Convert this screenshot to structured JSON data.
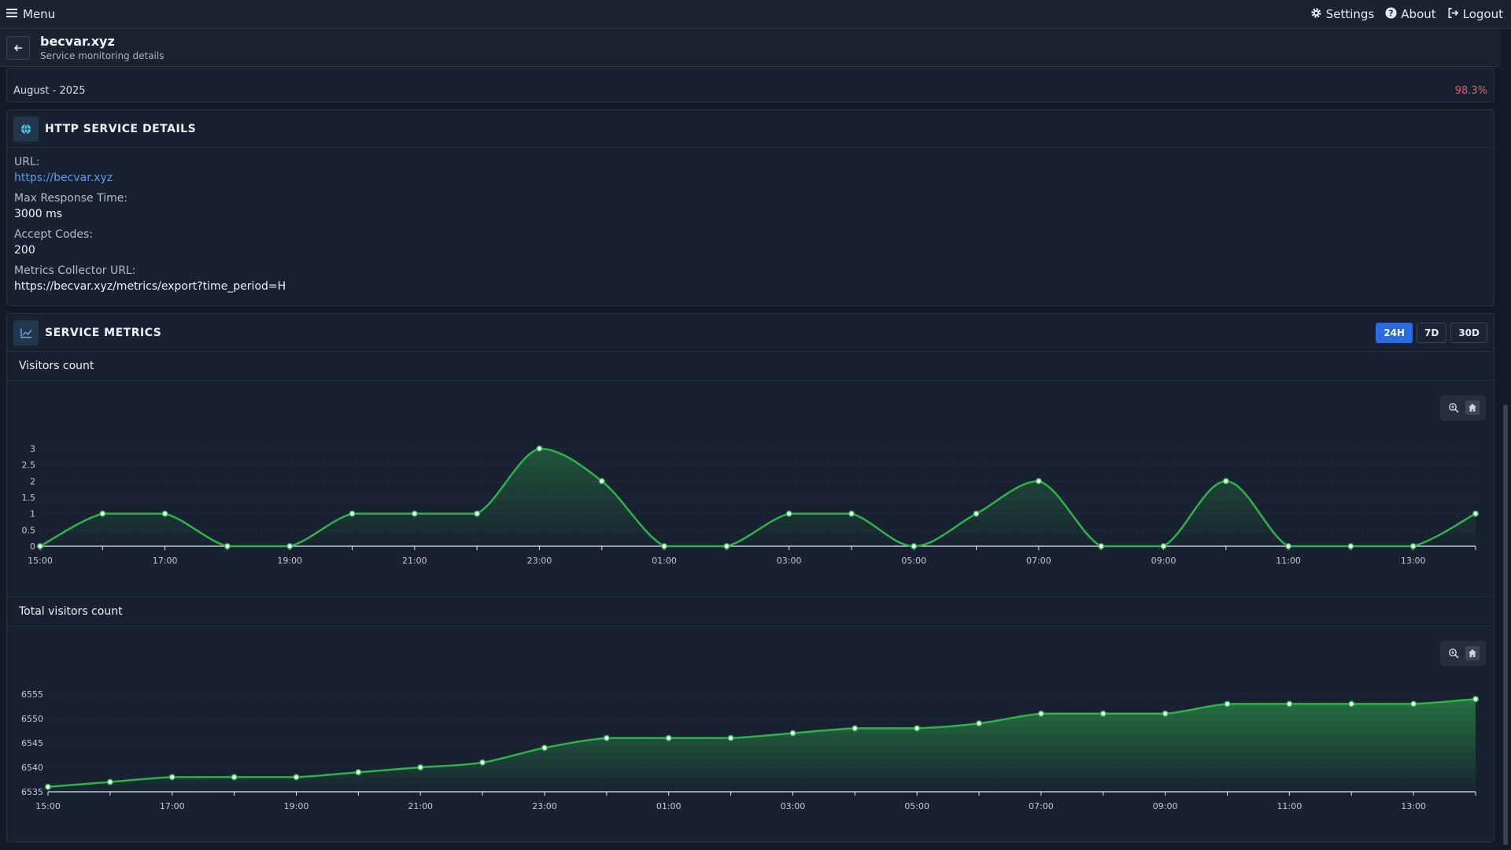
{
  "topbar": {
    "menu_label": "Menu",
    "settings_label": "Settings",
    "about_label": "About",
    "logout_label": "Logout"
  },
  "header": {
    "title": "becvar.xyz",
    "subtitle": "Service monitoring details"
  },
  "uptime": {
    "period": "August - 2025",
    "percent": "98.3%"
  },
  "http_details": {
    "section_title": "HTTP SERVICE DETAILS",
    "url_label": "URL:",
    "url_value": "https://becvar.xyz",
    "max_response_label": "Max Response Time:",
    "max_response_value": "3000 ms",
    "accept_codes_label": "Accept Codes:",
    "accept_codes_value": "200",
    "metrics_url_label": "Metrics Collector URL:",
    "metrics_url_value": "https://becvar.xyz/metrics/export?time_period=H"
  },
  "metrics": {
    "section_title": "SERVICE METRICS",
    "periods": [
      "24H",
      "7D",
      "30D"
    ],
    "active_period": "24H"
  },
  "colors": {
    "line": "#2fb24c",
    "accent": "#2a6be0",
    "downtime": "#e0606a",
    "link": "#5b9ef0"
  },
  "chart_data": [
    {
      "type": "area",
      "title": "Visitors count",
      "x": [
        "15:00",
        "16:00",
        "17:00",
        "18:00",
        "19:00",
        "20:00",
        "21:00",
        "22:00",
        "23:00",
        "00:00",
        "01:00",
        "02:00",
        "03:00",
        "04:00",
        "05:00",
        "06:00",
        "07:00",
        "08:00",
        "09:00",
        "10:00",
        "11:00",
        "12:00",
        "13:00",
        "14:00"
      ],
      "x_tick_labels": [
        "15:00",
        "17:00",
        "19:00",
        "21:00",
        "23:00",
        "01:00",
        "03:00",
        "05:00",
        "07:00",
        "09:00",
        "11:00",
        "13:00"
      ],
      "values": [
        0,
        1,
        1,
        0,
        0,
        1,
        1,
        1,
        3,
        2,
        0,
        0,
        1,
        1,
        0,
        1,
        2,
        0,
        0,
        2,
        0,
        0,
        0,
        1
      ],
      "y_ticks": [
        "0",
        "0.5",
        "1",
        "1.5",
        "2",
        "2.5",
        "3"
      ],
      "ylim": [
        0,
        3
      ],
      "grid": true
    },
    {
      "type": "area",
      "title": "Total visitors count",
      "x": [
        "15:00",
        "16:00",
        "17:00",
        "18:00",
        "19:00",
        "20:00",
        "21:00",
        "22:00",
        "23:00",
        "00:00",
        "01:00",
        "02:00",
        "03:00",
        "04:00",
        "05:00",
        "06:00",
        "07:00",
        "08:00",
        "09:00",
        "10:00",
        "11:00",
        "12:00",
        "13:00",
        "14:00"
      ],
      "x_tick_labels": [
        "15:00",
        "17:00",
        "19:00",
        "21:00",
        "23:00",
        "01:00",
        "03:00",
        "05:00",
        "07:00",
        "09:00",
        "11:00",
        "13:00"
      ],
      "values": [
        6536,
        6537,
        6538,
        6538,
        6538,
        6539,
        6540,
        6541,
        6544,
        6546,
        6546,
        6546,
        6547,
        6548,
        6548,
        6549,
        6551,
        6551,
        6551,
        6553,
        6553,
        6553,
        6553,
        6554
      ],
      "y_ticks": [
        "6535",
        "6540",
        "6545",
        "6550",
        "6555"
      ],
      "ylim": [
        6535,
        6555
      ],
      "grid": true
    }
  ]
}
